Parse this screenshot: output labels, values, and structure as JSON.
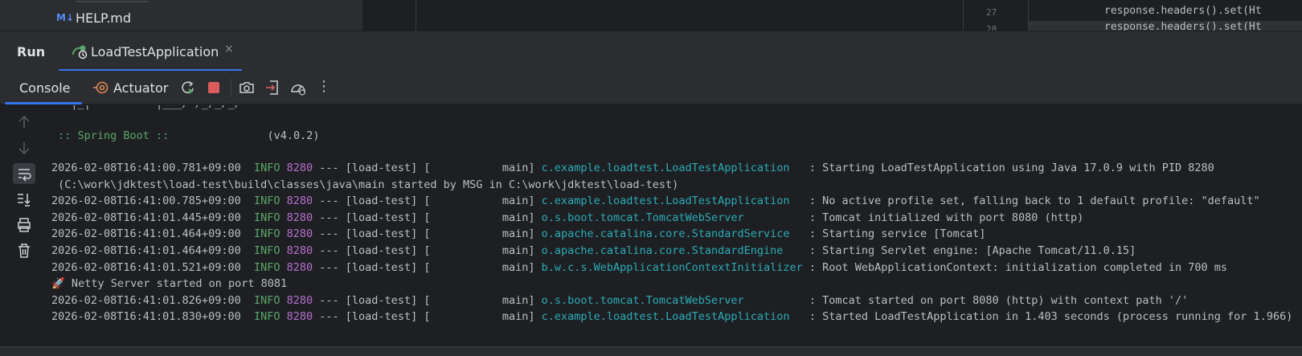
{
  "project": {
    "file_label": "HELP.md",
    "file_icon_text": "M↓"
  },
  "editor": {
    "line_numbers": [
      "27",
      "28"
    ],
    "code_lines": [
      "response.headers().set(Ht",
      "response.headers().set(Ht"
    ]
  },
  "run_panel": {
    "title": "Run",
    "tab_label": "LoadTestApplication",
    "tab_close": "×"
  },
  "toolbar": {
    "console_label": "Console",
    "actuator_label": "Actuator",
    "more": "⋮"
  },
  "console": {
    "banner_cut": "   |_|          |___/=/_/_/_/",
    "spring_label": " :: Spring Boot :: ",
    "spring_version": "(v4.0.2)",
    "lines": [
      {
        "ts": "2026-02-08T16:41:00.781+09:00",
        "level": "INFO",
        "pid": "8280",
        "mid": "--- [load-test] [           main]",
        "logger": "c.example.loadtest.LoadTestApplication  ",
        "msg": " : Starting LoadTestApplication using Java 17.0.9 with PID 8280"
      },
      {
        "plain": " (C:\\work\\jdktest\\load-test\\build\\classes\\java\\main started by MSG in C:\\work\\jdktest\\load-test)"
      },
      {
        "ts": "2026-02-08T16:41:00.785+09:00",
        "level": "INFO",
        "pid": "8280",
        "mid": "--- [load-test] [           main]",
        "logger": "c.example.loadtest.LoadTestApplication  ",
        "msg": " : No active profile set, falling back to 1 default profile: \"default\""
      },
      {
        "ts": "2026-02-08T16:41:01.445+09:00",
        "level": "INFO",
        "pid": "8280",
        "mid": "--- [load-test] [           main]",
        "logger": "o.s.boot.tomcat.TomcatWebServer         ",
        "msg": " : Tomcat initialized with port 8080 (http)"
      },
      {
        "ts": "2026-02-08T16:41:01.464+09:00",
        "level": "INFO",
        "pid": "8280",
        "mid": "--- [load-test] [           main]",
        "logger": "o.apache.catalina.core.StandardService  ",
        "msg": " : Starting service [Tomcat]"
      },
      {
        "ts": "2026-02-08T16:41:01.464+09:00",
        "level": "INFO",
        "pid": "8280",
        "mid": "--- [load-test] [           main]",
        "logger": "o.apache.catalina.core.StandardEngine   ",
        "msg": " : Starting Servlet engine: [Apache Tomcat/11.0.15]"
      },
      {
        "ts": "2026-02-08T16:41:01.521+09:00",
        "level": "INFO",
        "pid": "8280",
        "mid": "--- [load-test] [           main]",
        "logger": "b.w.c.s.WebApplicationContextInitializer",
        "msg": " : Root WebApplicationContext: initialization completed in 700 ms"
      },
      {
        "plain": "🚀 Netty Server started on port 8081"
      },
      {
        "ts": "2026-02-08T16:41:01.826+09:00",
        "level": "INFO",
        "pid": "8280",
        "mid": "--- [load-test] [           main]",
        "logger": "o.s.boot.tomcat.TomcatWebServer         ",
        "msg": " : Tomcat started on port 8080 (http) with context path '/'"
      },
      {
        "ts": "2026-02-08T16:41:01.830+09:00",
        "level": "INFO",
        "pid": "8280",
        "mid": "--- [load-test] [           main]",
        "logger": "c.example.loadtest.LoadTestApplication  ",
        "msg": " : Started LoadTestApplication in 1.403 seconds (process running for 1.966)"
      }
    ]
  }
}
